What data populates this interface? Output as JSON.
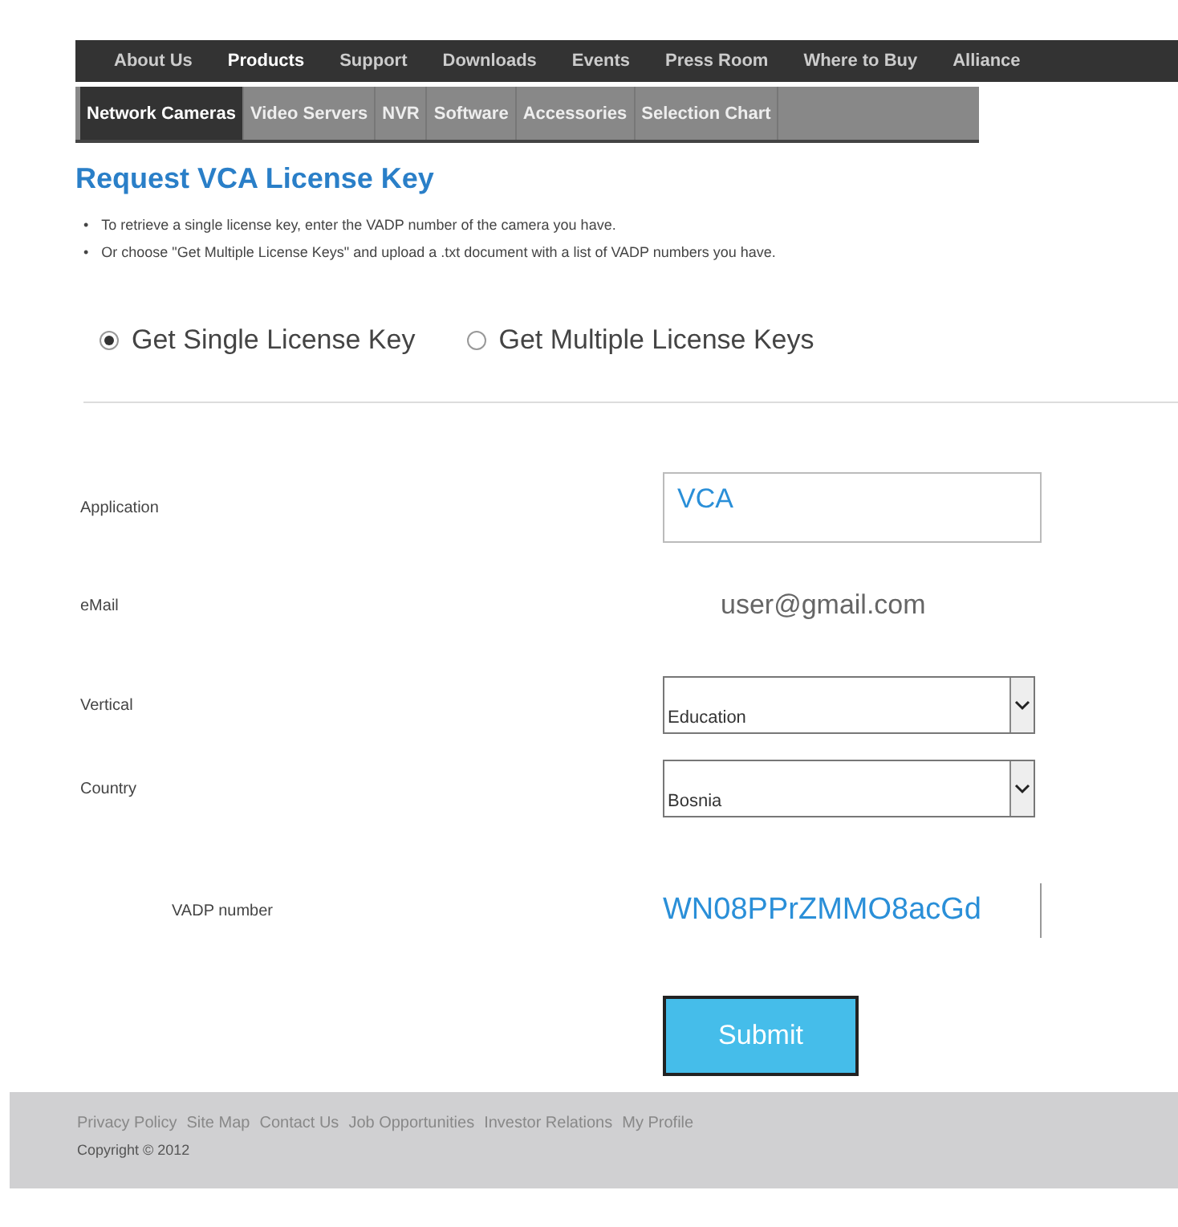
{
  "top_nav": [
    {
      "label": "About Us",
      "selected": false
    },
    {
      "label": "Products",
      "selected": true
    },
    {
      "label": "Support",
      "selected": false
    },
    {
      "label": "Downloads",
      "selected": false
    },
    {
      "label": "Events",
      "selected": false
    },
    {
      "label": "Press Room",
      "selected": false
    },
    {
      "label": "Where to Buy",
      "selected": false
    },
    {
      "label": "Alliance",
      "selected": false
    }
  ],
  "sub_nav": [
    {
      "label": "Network Cameras",
      "selected": true
    },
    {
      "label": "Video Servers",
      "selected": false
    },
    {
      "label": "NVR",
      "selected": false
    },
    {
      "label": "Software",
      "selected": false
    },
    {
      "label": "Accessories",
      "selected": false
    },
    {
      "label": "Selection Chart",
      "selected": false
    }
  ],
  "title": "Request VCA License Key",
  "instructions": [
    {
      "bullet": "•",
      "text": "To retrieve a single license key, enter the VADP number of the camera you have."
    },
    {
      "bullet": "•",
      "text": "Or choose \"Get Multiple License Keys\" and upload a .txt document with a list of VADP numbers you have."
    }
  ],
  "modes": [
    {
      "label": "Get Single License Key",
      "selected": true
    },
    {
      "label": "Get Multiple License Keys",
      "selected": false
    }
  ],
  "form": [
    {
      "kind": "text",
      "label": "Application",
      "value": "VCA"
    },
    {
      "kind": "plain",
      "label": "eMail",
      "value": "user@gmail.com"
    },
    {
      "kind": "select",
      "label": "Vertical",
      "value": "Education"
    },
    {
      "kind": "select",
      "label": "Country",
      "value": "Bosnia"
    },
    {
      "kind": "code",
      "label": "VADP number",
      "value": "WN08PPrZMMO8acGd"
    }
  ],
  "submit": "Submit",
  "footer": {
    "links": [
      "Privacy Policy",
      "Site Map",
      "Contact Us",
      "Job Opportunities",
      "Investor Relations",
      "My Profile"
    ],
    "copyright": "Copyright © 2012"
  }
}
